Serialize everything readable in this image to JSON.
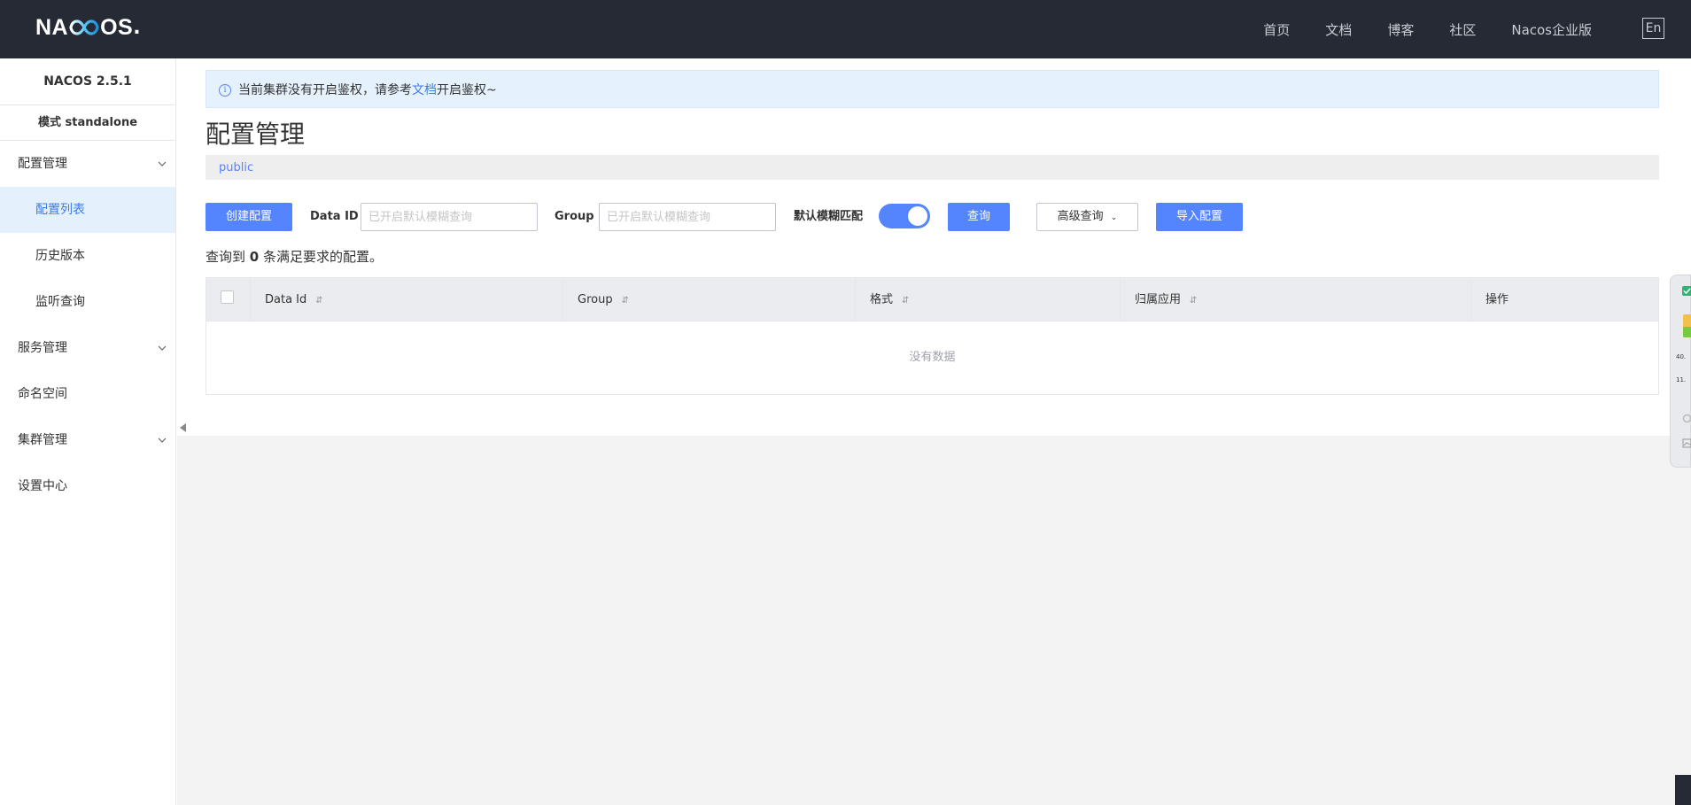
{
  "header": {
    "logo_left": "NA",
    "logo_right": "OS",
    "logo_dot": ".",
    "nav": [
      "首页",
      "文档",
      "博客",
      "社区",
      "Nacos企业版"
    ],
    "lang": "En"
  },
  "sidebar": {
    "version": "NACOS 2.5.1",
    "mode": "模式 standalone",
    "items": [
      {
        "label": "配置管理",
        "expandable": true
      },
      {
        "label": "配置列表",
        "sub": true,
        "active": true
      },
      {
        "label": "历史版本",
        "sub": true
      },
      {
        "label": "监听查询",
        "sub": true
      },
      {
        "label": "服务管理",
        "expandable": true
      },
      {
        "label": "命名空间"
      },
      {
        "label": "集群管理",
        "expandable": true
      },
      {
        "label": "设置中心"
      }
    ]
  },
  "notice": {
    "prefix": "当前集群没有开启鉴权，请参考",
    "link": "文档",
    "suffix": "开启鉴权~"
  },
  "page": {
    "title": "配置管理",
    "namespace": "public"
  },
  "toolbar": {
    "create_label": "创建配置",
    "data_id_label": "Data ID",
    "data_id_placeholder": "已开启默认模糊查询",
    "group_label": "Group",
    "group_placeholder": "已开启默认模糊查询",
    "fuzzy_label": "默认模糊匹配",
    "fuzzy_on": true,
    "query_label": "查询",
    "advanced_label": "高级查询",
    "import_label": "导入配置"
  },
  "result": {
    "prefix": "查询到",
    "count": "0",
    "suffix": "条满足要求的配置。"
  },
  "table": {
    "columns": [
      "Data Id",
      "Group",
      "格式",
      "归属应用",
      "操作"
    ],
    "empty_text": "没有数据"
  },
  "widget": {
    "text1": "40.",
    "text2": "11."
  },
  "colors": {
    "topbar": "#252a34",
    "primary": "#5584ff",
    "active_bg": "#e5f0fd",
    "link": "#3e7be8"
  }
}
